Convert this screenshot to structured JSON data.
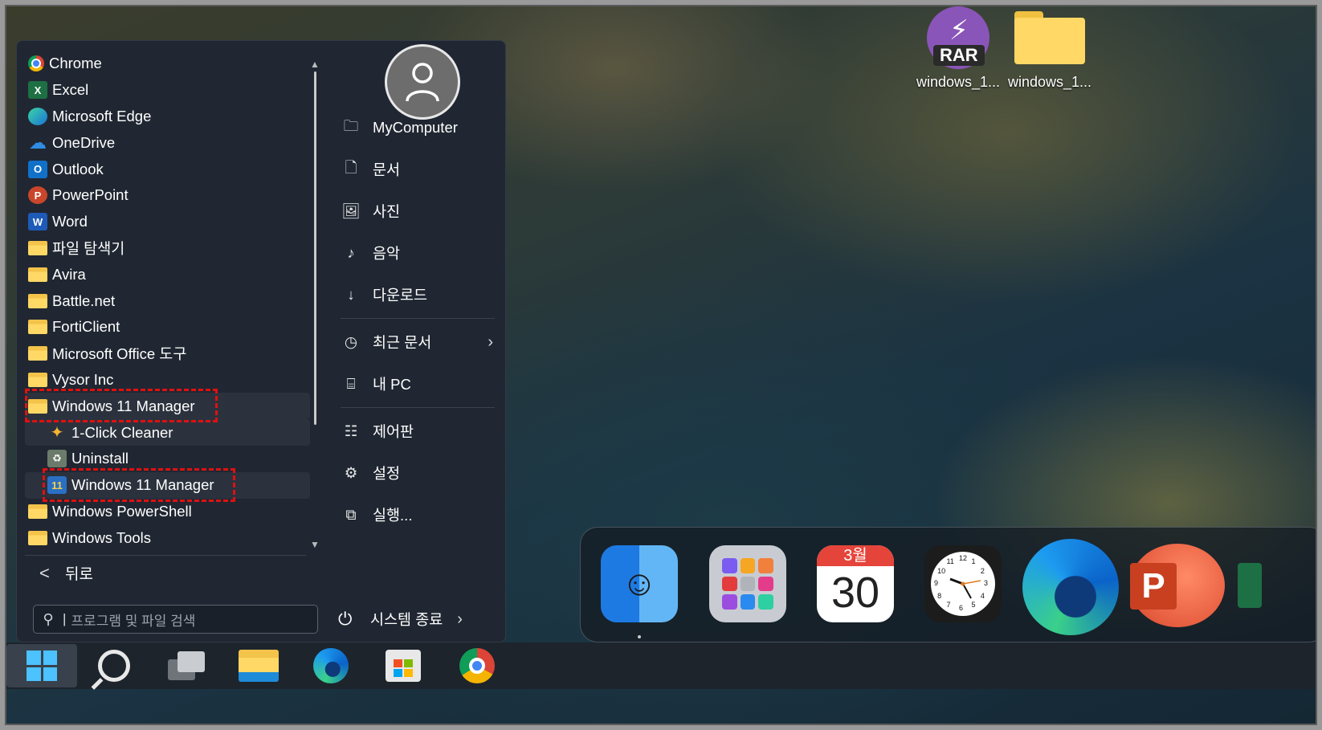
{
  "desktop": {
    "icons": [
      {
        "label": "windows_1...",
        "icon": "winrar-archive-icon",
        "overlay": "RAR"
      },
      {
        "label": "windows_1...",
        "icon": "folder-icon"
      }
    ]
  },
  "start_menu": {
    "apps": [
      {
        "label": "Chrome",
        "icon": "chrome-icon"
      },
      {
        "label": "Excel",
        "icon": "excel-icon",
        "glyph": "X"
      },
      {
        "label": "Microsoft Edge",
        "icon": "edge-icon"
      },
      {
        "label": "OneDrive",
        "icon": "onedrive-icon",
        "glyph": "☁"
      },
      {
        "label": "Outlook",
        "icon": "outlook-icon",
        "glyph": "O"
      },
      {
        "label": "PowerPoint",
        "icon": "powerpoint-icon",
        "glyph": "P"
      },
      {
        "label": "Word",
        "icon": "word-icon",
        "glyph": "W"
      },
      {
        "label": "파일 탐색기",
        "icon": "file-explorer-icon"
      },
      {
        "label": "Avira",
        "icon": "folder-icon"
      },
      {
        "label": "Battle.net",
        "icon": "folder-icon"
      },
      {
        "label": "FortiClient",
        "icon": "folder-icon"
      },
      {
        "label": "Microsoft Office 도구",
        "icon": "folder-icon"
      },
      {
        "label": "Vysor Inc",
        "icon": "folder-icon"
      },
      {
        "label": "Windows 11 Manager",
        "icon": "folder-icon"
      },
      {
        "label": "1-Click Cleaner",
        "icon": "cleaner-icon",
        "glyph": "✦"
      },
      {
        "label": "Uninstall",
        "icon": "uninstall-icon",
        "glyph": "♻"
      },
      {
        "label": "Windows 11 Manager",
        "icon": "windows11-manager-icon",
        "glyph": "11"
      },
      {
        "label": "Windows PowerShell",
        "icon": "folder-icon"
      },
      {
        "label": "Windows Tools",
        "icon": "folder-icon"
      }
    ],
    "back_label": "뒤로",
    "back_glyph": "<",
    "search": {
      "placeholder": "프로그램 및 파일 검색",
      "glyph": "⚲",
      "caret": "|"
    },
    "scroll": {
      "up": "▲",
      "down": "▼"
    },
    "links": [
      {
        "label": "MyComputer",
        "icon": "user-folder-icon",
        "glyph": "🗀"
      },
      {
        "label": "문서",
        "icon": "document-icon",
        "glyph": "🗋"
      },
      {
        "label": "사진",
        "icon": "picture-icon",
        "glyph": "🖼"
      },
      {
        "label": "음악",
        "icon": "music-note-icon",
        "glyph": "♪"
      },
      {
        "label": "다운로드",
        "icon": "download-icon",
        "glyph": "↓"
      }
    ],
    "links2": [
      {
        "label": "최근 문서",
        "icon": "clock-icon",
        "glyph": "◷",
        "arrow": "›"
      },
      {
        "label": "내 PC",
        "icon": "pc-icon",
        "glyph": "⌸"
      }
    ],
    "links3": [
      {
        "label": "제어판",
        "icon": "control-panel-icon",
        "glyph": "☷"
      },
      {
        "label": "설정",
        "icon": "settings-gear-icon",
        "glyph": "⚙"
      },
      {
        "label": "실행...",
        "icon": "run-icon",
        "glyph": "⧉"
      }
    ],
    "power": {
      "label": "시스템 종료",
      "glyph": "⏻",
      "arrow": "›"
    }
  },
  "dock": {
    "calendar": {
      "month": "3월",
      "day": "30"
    },
    "finder_glyph": "☺",
    "ppt_glyph": "P",
    "clock_numerals": [
      "12",
      "1",
      "2",
      "3",
      "4",
      "5",
      "6",
      "7",
      "8",
      "9",
      "10",
      "11"
    ]
  },
  "colors": {
    "accent": "#4cc2ff",
    "highlight_box": "#e01010",
    "menu_bg": "#202732"
  }
}
